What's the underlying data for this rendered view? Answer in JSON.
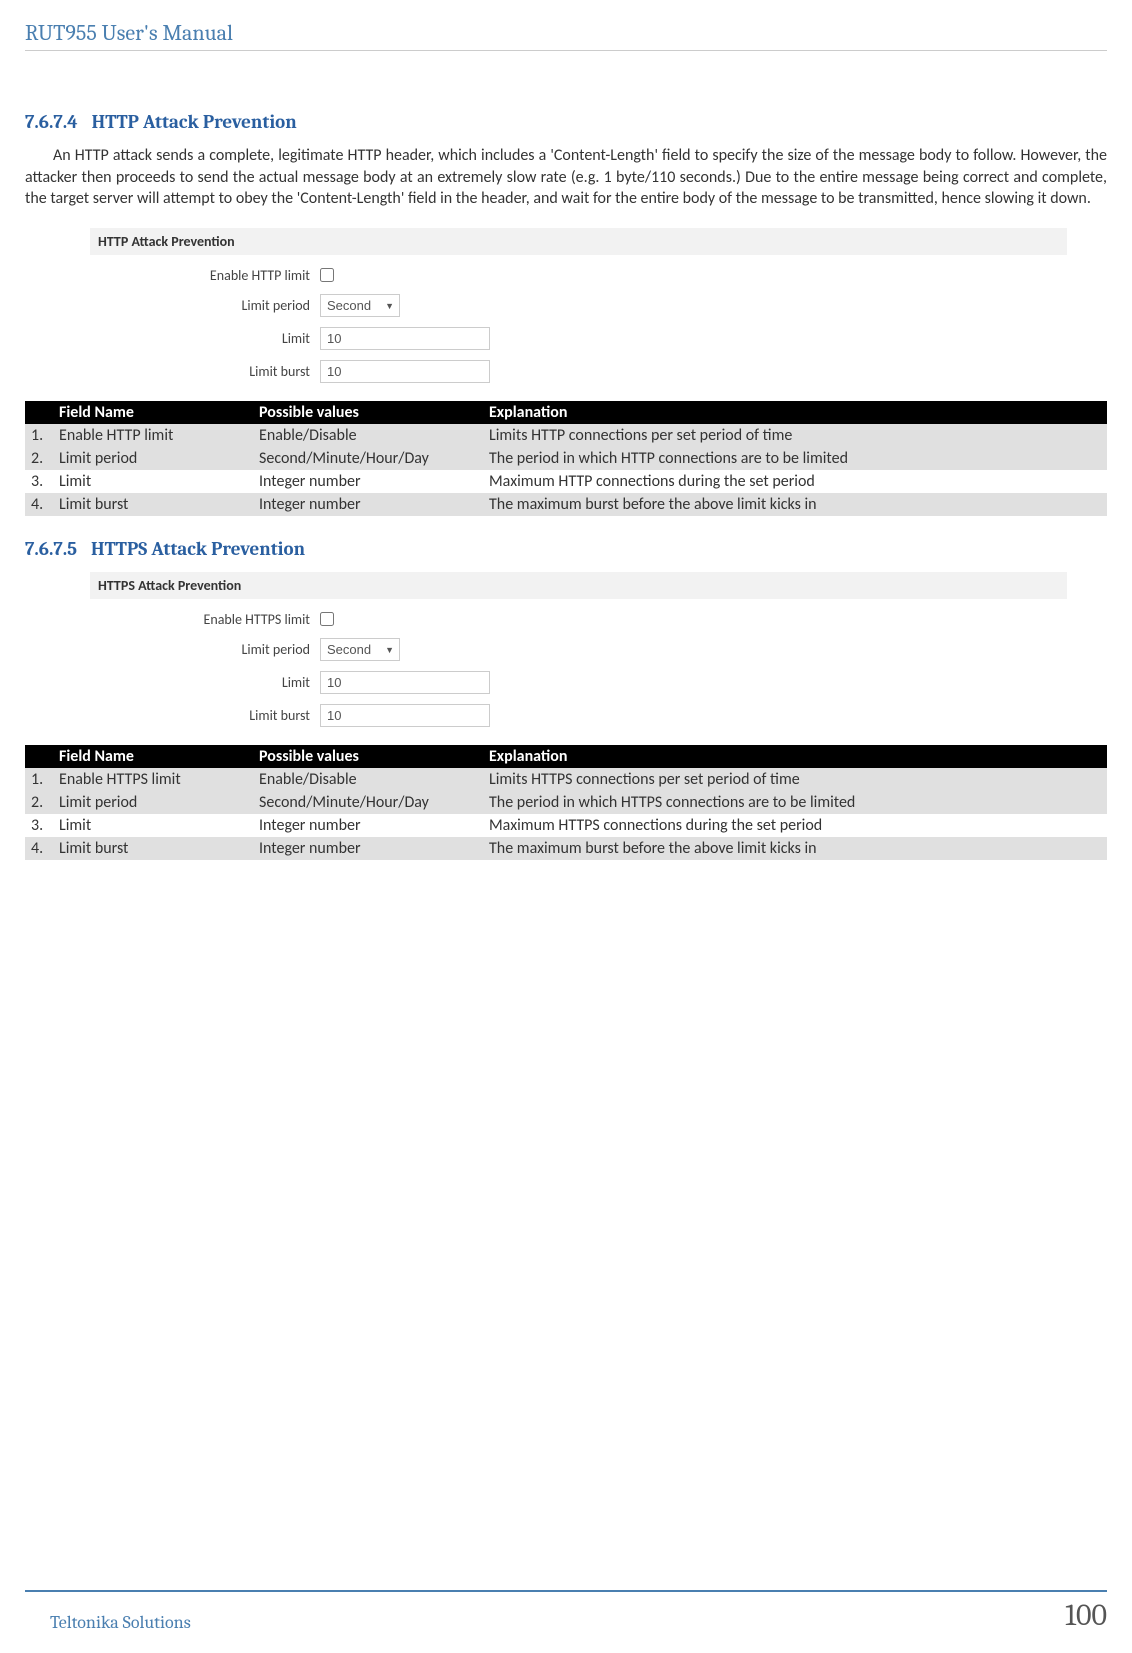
{
  "header": {
    "title": "RUT955 User's Manual"
  },
  "section1": {
    "num": "7.6.7.4",
    "title": "HTTP Attack Prevention",
    "paragraph": "An HTTP attack sends a complete, legitimate HTTP header, which includes a 'Content-Length' field to specify the size of the message body to follow. However, the attacker then proceeds to send the actual message body at an extremely slow rate (e.g. 1 byte/110 seconds.) Due to the entire message being correct and complete, the target server will attempt to obey the 'Content-Length' field in the header, and wait for the entire body of the message to be transmitted, hence slowing it down.",
    "form": {
      "heading": "HTTP Attack Prevention",
      "enable_label": "Enable HTTP limit",
      "period_label": "Limit period",
      "period_value": "Second",
      "limit_label": "Limit",
      "limit_value": "10",
      "burst_label": "Limit burst",
      "burst_value": "10"
    },
    "table": {
      "headers": [
        "",
        "Field Name",
        "Possible values",
        "Explanation"
      ],
      "rows": [
        [
          "1.",
          "Enable HTTP limit",
          "Enable/Disable",
          "Limits HTTP connections per set period of time"
        ],
        [
          "2.",
          "Limit period",
          "Second/Minute/Hour/Day",
          "The period in which HTTP connections are to be limited"
        ],
        [
          "3.",
          "Limit",
          "Integer number",
          "Maximum HTTP connections during the set period"
        ],
        [
          "4.",
          "Limit burst",
          "Integer number",
          "The maximum burst before the above limit kicks in"
        ]
      ]
    }
  },
  "section2": {
    "num": "7.6.7.5",
    "title": "HTTPS Attack Prevention",
    "form": {
      "heading": "HTTPS Attack Prevention",
      "enable_label": "Enable HTTPS limit",
      "period_label": "Limit period",
      "period_value": "Second",
      "limit_label": "Limit",
      "limit_value": "10",
      "burst_label": "Limit burst",
      "burst_value": "10"
    },
    "table": {
      "headers": [
        "",
        "Field Name",
        "Possible values",
        "Explanation"
      ],
      "rows": [
        [
          "1.",
          "Enable HTTPS limit",
          "Enable/Disable",
          "Limits HTTPS connections per set period of time"
        ],
        [
          "2.",
          "Limit period",
          "Second/Minute/Hour/Day",
          "The period in which HTTPS connections are to be limited"
        ],
        [
          "3.",
          "Limit",
          "Integer number",
          "Maximum HTTPS connections during the set period"
        ],
        [
          "4.",
          "Limit burst",
          "Integer number",
          "The maximum burst before the above limit kicks in"
        ]
      ]
    }
  },
  "footer": {
    "left": "Teltonika Solutions",
    "page": "100"
  }
}
